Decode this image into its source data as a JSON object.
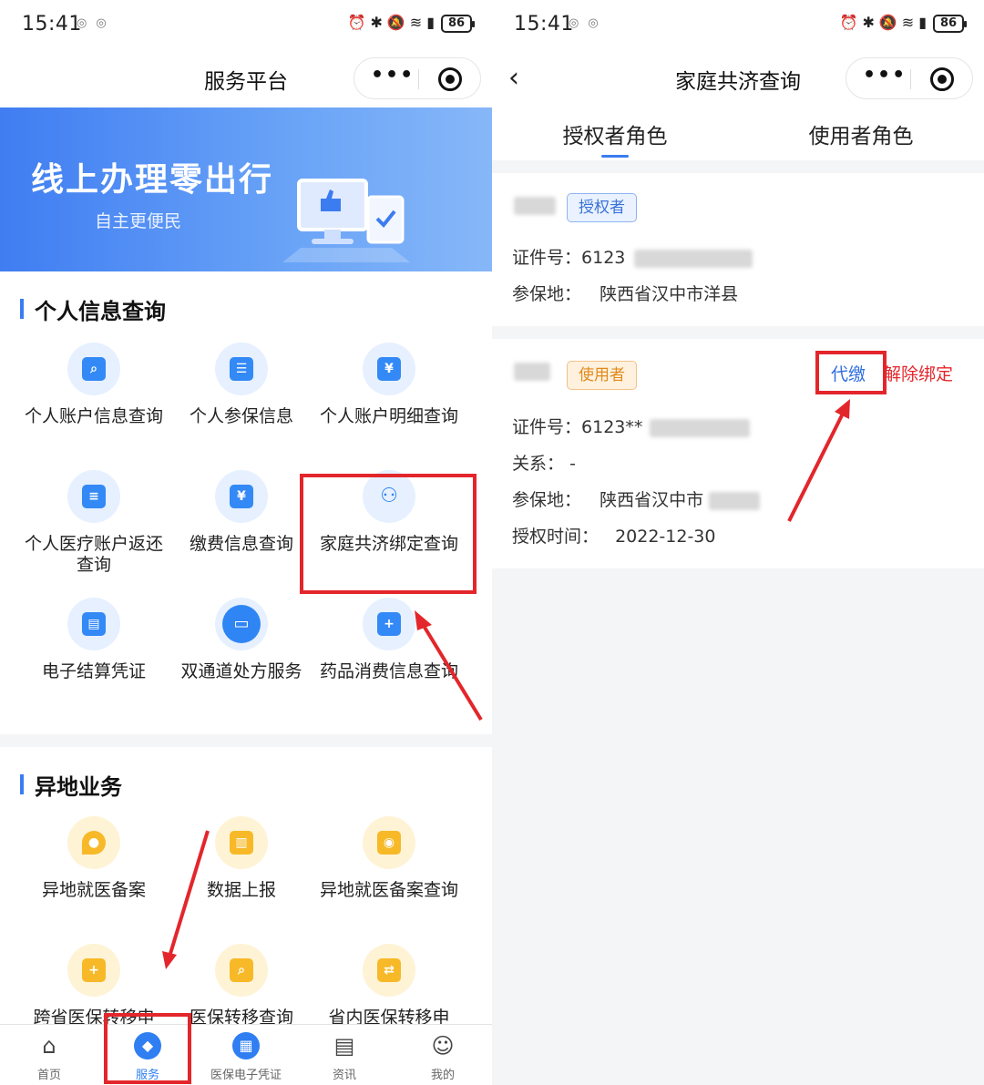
{
  "status": {
    "time": "15:41",
    "battery": "86"
  },
  "left": {
    "nav_title": "服务平台",
    "banner": {
      "title": "线上办理零出行",
      "subtitle": "自主更便民"
    },
    "section1": {
      "title": "个人信息查询",
      "items": [
        {
          "label": "个人账户信息查询",
          "icon": "search-card-icon"
        },
        {
          "label": "个人参保信息",
          "icon": "id-card-icon"
        },
        {
          "label": "个人账户明细查询",
          "icon": "yuan-card-icon"
        },
        {
          "label": "个人医疗账户返还查询",
          "icon": "document-icon"
        },
        {
          "label": "缴费信息查询",
          "icon": "yuan-receipt-icon"
        },
        {
          "label": "家庭共济绑定查询",
          "icon": "family-icon"
        },
        {
          "label": "电子结算凭证",
          "icon": "ticket-icon"
        },
        {
          "label": "双通道处方服务",
          "icon": "chat-icon"
        },
        {
          "label": "药品消费信息查询",
          "icon": "medicine-folder-icon"
        }
      ]
    },
    "section2": {
      "title": "异地业务",
      "items": [
        {
          "label": "异地就医备案",
          "icon": "location-pin-icon"
        },
        {
          "label": "数据上报",
          "icon": "bar-chart-icon"
        },
        {
          "label": "异地就医备案查询",
          "icon": "record-search-icon"
        },
        {
          "label": "跨省医保转移申",
          "icon": "medical-transfer-icon"
        },
        {
          "label": "医保转移查询",
          "icon": "transfer-search-icon"
        },
        {
          "label": "省内医保转移申",
          "icon": "transfer-arrow-icon"
        }
      ]
    },
    "tabbar": [
      {
        "label": "首页",
        "icon": "home-icon"
      },
      {
        "label": "服务",
        "icon": "compass-icon"
      },
      {
        "label": "医保电子凭证",
        "icon": "qr-code-icon"
      },
      {
        "label": "资讯",
        "icon": "news-icon"
      },
      {
        "label": "我的",
        "icon": "user-icon"
      }
    ]
  },
  "right": {
    "nav_title": "家庭共济查询",
    "tabs": [
      "授权者角色",
      "使用者角色"
    ],
    "authorizer": {
      "badge": "授权者",
      "id_label": "证件号：",
      "id_value": "6123",
      "insured_label": "参保地：",
      "insured_value": "陕西省汉中市洋县"
    },
    "user": {
      "badge": "使用者",
      "pay_label": "代缴",
      "unbind_label": "解除绑定",
      "id_label": "证件号：",
      "id_value": "6123**",
      "relation_label": "关系：",
      "relation_value": "-",
      "insured_label": "参保地：",
      "insured_value": "陕西省汉中市",
      "auth_time_label": "授权时间：",
      "auth_time_value": "2022-12-30"
    }
  },
  "colors": {
    "accent": "#3b7cf0",
    "annotation": "#e3262b"
  }
}
